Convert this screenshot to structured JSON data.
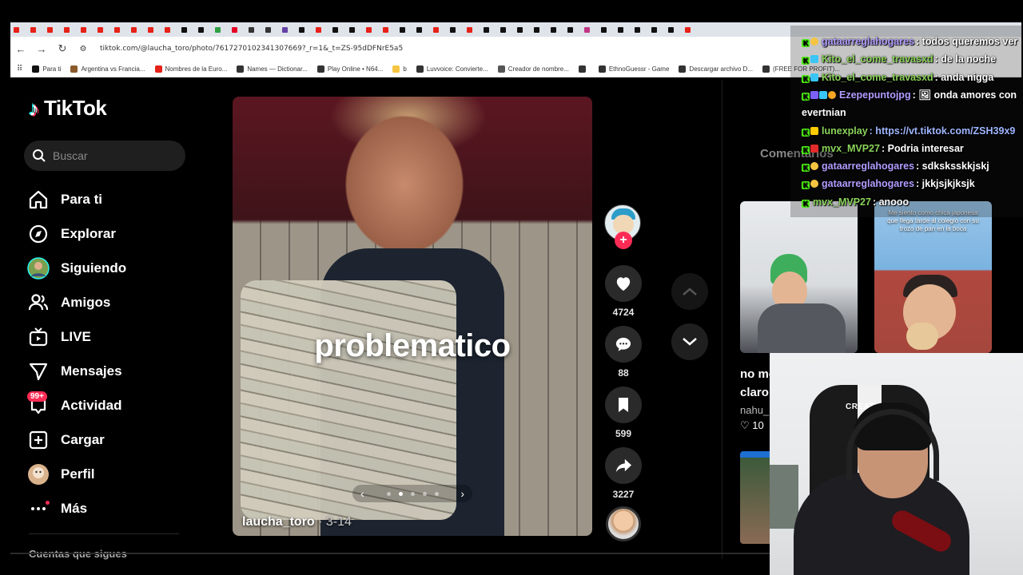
{
  "browser": {
    "url": "tiktok.com/@laucha_toro/photo/7617270102341307669?_r=1&_t=ZS-95dDFNrE5a5",
    "tab_colors": [
      "#e62117",
      "#e62117",
      "#e62117",
      "#e62117",
      "#e62117",
      "#e62117",
      "#e62117",
      "#e62117",
      "#e62117",
      "#e62117",
      "#111111",
      "#111111",
      "#2ea043",
      "#e60023",
      "#333333",
      "#333333",
      "#6441a5",
      "#111111",
      "#e62117",
      "#111111",
      "#111111",
      "#e62117",
      "#e62117",
      "#111111",
      "#111111",
      "#e62117",
      "#111111",
      "#e62117",
      "#111111",
      "#111111",
      "#111111",
      "#111111",
      "#111111",
      "#111111",
      "#c13584",
      "#111111",
      "#111111",
      "#111111",
      "#111111",
      "#111111",
      "#e62117"
    ],
    "bookmarks": [
      {
        "label": "Para ti",
        "color": "#111111"
      },
      {
        "label": "Argentina vs Francia...",
        "color": "#8b5a2b"
      },
      {
        "label": "Nombres de la Euro...",
        "color": "#e62117"
      },
      {
        "label": "Names — Dictionar...",
        "color": "#333333"
      },
      {
        "label": "Play Online • N64...",
        "color": "#333333"
      },
      {
        "label": "b",
        "color": "#f5c542"
      },
      {
        "label": "Luvvoice: Convierte...",
        "color": "#333333"
      },
      {
        "label": "Creador de nombre...",
        "color": "#555555"
      },
      {
        "label": "",
        "color": "#333333"
      },
      {
        "label": "EthnoGuessr - Game",
        "color": "#333333"
      },
      {
        "label": "Descargar archivo D...",
        "color": "#333333"
      },
      {
        "label": "(FREE FOR PROFIT)...",
        "color": "#333333"
      }
    ]
  },
  "sidebar": {
    "logo": "TikTok",
    "search_placeholder": "Buscar",
    "items": [
      {
        "label": "Para ti",
        "icon": "home-icon"
      },
      {
        "label": "Explorar",
        "icon": "compass-icon"
      },
      {
        "label": "Siguiendo",
        "icon": "following-avatar-icon"
      },
      {
        "label": "Amigos",
        "icon": "friends-icon"
      },
      {
        "label": "LIVE",
        "icon": "live-tv-icon"
      },
      {
        "label": "Mensajes",
        "icon": "messages-icon"
      },
      {
        "label": "Actividad",
        "icon": "activity-icon",
        "badge": "99+"
      },
      {
        "label": "Cargar",
        "icon": "upload-icon"
      },
      {
        "label": "Perfil",
        "icon": "profile-avatar-icon"
      },
      {
        "label": "Más",
        "icon": "more-icon"
      }
    ],
    "following_heading": "Cuentas que sigues"
  },
  "post": {
    "caption_overlay": "problematico",
    "author": "laucha_toro",
    "date": " · 3-14",
    "slides_total": 5,
    "slide_active": 2
  },
  "actions": {
    "likes": "4724",
    "comments": "88",
    "saves": "599",
    "shares": "3227"
  },
  "right_panel": {
    "comments_tab": "Comentarios",
    "thumb2_text": "Me siento como chica japonesa que llega tarde al colegio con su trozo de pan en la boca",
    "rec_title_1": "no me",
    "rec_title_2": "claro",
    "rec_author": "nahu_",
    "rec_likes": "♡ 10"
  },
  "chat": {
    "messages": [
      {
        "user": "gataarreglahogares",
        "text": ": todos queremos ver",
        "name_color": "#b19cff",
        "icons": [
          "k",
          "face"
        ]
      },
      {
        "user": "Kito_el_come_travasxd",
        "text": ": de la noche",
        "name_color": "#8bd35a",
        "icons": [
          "k",
          "cyan"
        ]
      },
      {
        "user": "Kito_el_come_travasxd",
        "text": ": anda nigga",
        "name_color": "#8bd35a",
        "icons": [
          "k",
          "cyan"
        ]
      },
      {
        "user": "Ezepepuntojpg",
        "text": ": 🖼 onda amores con",
        "name_color": "#b19cff",
        "icons": [
          "k",
          "star",
          "cyan",
          "gold"
        ]
      },
      {
        "user": "",
        "text": "evertnian",
        "name_color": "#ffffff",
        "icons": []
      },
      {
        "user": "lunexplay",
        "text": ": https://vt.tiktok.com/ZSH39x9",
        "name_color": "#8bd35a",
        "icons": [
          "k",
          "crown"
        ],
        "link": true
      },
      {
        "user": "mvx_MVP27",
        "text": ": Podria interesar",
        "name_color": "#8bd35a",
        "icons": [
          "k",
          "heart"
        ]
      },
      {
        "user": "gataarreglahogares",
        "text": ": sdksksskkjskj",
        "name_color": "#b19cff",
        "icons": [
          "k",
          "face"
        ]
      },
      {
        "user": "gataarreglahogares",
        "text": ": jkkjsjkjksjk",
        "name_color": "#b19cff",
        "icons": [
          "k",
          "face"
        ]
      },
      {
        "user": "mvx_MVP27",
        "text": ": anooo",
        "name_color": "#8bd35a",
        "icons": [
          "k"
        ]
      }
    ]
  },
  "webcam": {
    "chair_brand": "CREATION"
  }
}
